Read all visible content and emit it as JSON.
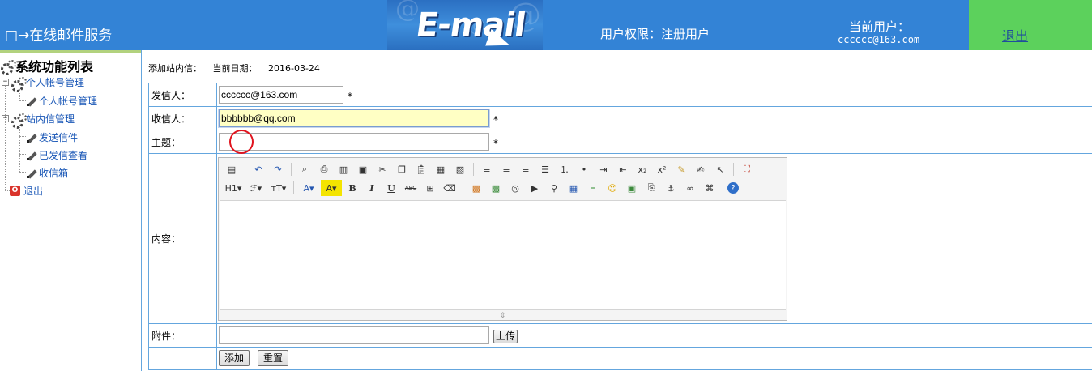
{
  "header": {
    "app_title": "□→在线邮件服务",
    "banner_logo": "E-mail",
    "permission": "用户权限：注册用户",
    "current_user_label": "当前用户：",
    "current_user_value": "cccccc@163.com",
    "logout": "退出"
  },
  "sidebar": {
    "root": "系统功能列表",
    "groups": [
      {
        "label": "个人帐号管理",
        "items": [
          "个人帐号管理"
        ]
      },
      {
        "label": "站内信管理",
        "items": [
          "发送信件",
          "已发信查看",
          "收信箱"
        ]
      }
    ],
    "exit": "退出"
  },
  "page": {
    "section_title": "添加站内信：",
    "date_label": "当前日期：",
    "date_value": "2016-03-24"
  },
  "form": {
    "sender_label": "发信人：",
    "sender_value": "cccccc@163.com",
    "recipient_label": "收信人：",
    "recipient_value": "bbbbbb@qq.com",
    "subject_label": "主题：",
    "subject_value": "",
    "content_label": "内容：",
    "attachment_label": "附件：",
    "attachment_value": "",
    "required_mark": "*",
    "upload_button": "上传",
    "add_button": "添加",
    "reset_button": "重置"
  },
  "editor_toolbar": {
    "row1": [
      "source-icon",
      "undo-icon",
      "redo-icon",
      "preview-icon",
      "print-icon",
      "template-icon",
      "code-icon",
      "cut-icon",
      "copy-icon",
      "paste-icon",
      "paste-text-icon",
      "paste-word-icon",
      "align-left-icon",
      "align-center-icon",
      "align-right-icon",
      "justify-icon",
      "ordered-list-icon",
      "unordered-list-icon",
      "indent-icon",
      "outdent-icon",
      "subscript-icon",
      "superscript-icon",
      "clear-format-icon",
      "select-all-icon",
      "select-icon",
      "fullscreen-icon"
    ],
    "row2_labels": {
      "heading": "H1",
      "font": "ℱ",
      "size": "тT",
      "bold": "B",
      "italic": "I",
      "underline": "U",
      "strike": "ABC"
    }
  }
}
